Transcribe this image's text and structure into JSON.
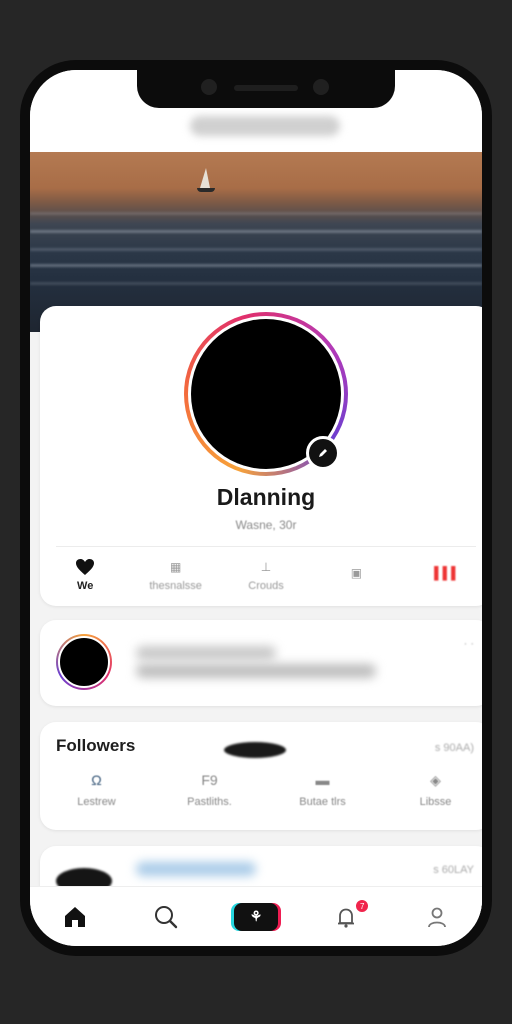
{
  "header": {
    "title": ""
  },
  "profile": {
    "name": "Dlanning",
    "handle": "Wasne, 30r"
  },
  "stats": [
    {
      "icon": "heart-icon",
      "label": "We",
      "active": true
    },
    {
      "icon": "stat-icon",
      "label": "thesnalsse",
      "active": false
    },
    {
      "icon": "stat-icon",
      "label": "Crouds",
      "active": false
    },
    {
      "icon": "stat-icon",
      "label": "",
      "active": false
    },
    {
      "icon": "stat-icon",
      "label": "",
      "active": false
    }
  ],
  "activity": {
    "meta": "· ·"
  },
  "followers": {
    "title": "Followers",
    "meta": "s 90AA)",
    "items": [
      {
        "icon": "Ω",
        "label": "Lestrew"
      },
      {
        "icon": "F9",
        "label": "Pastliths."
      },
      {
        "icon": "▬",
        "label": "Butae tlrs"
      },
      {
        "icon": "◈",
        "label": "Libsse"
      }
    ]
  },
  "card4": {
    "meta": "s 60LAY"
  },
  "tabbar": {
    "tabs": [
      "home",
      "search",
      "create",
      "notifications",
      "profile"
    ],
    "notification_badge": "7"
  },
  "colors": {
    "accent_red": "#ee1d52",
    "accent_cyan": "#26d7e0",
    "ring_start": "#f7a23a",
    "ring_end": "#6a3fd0"
  }
}
